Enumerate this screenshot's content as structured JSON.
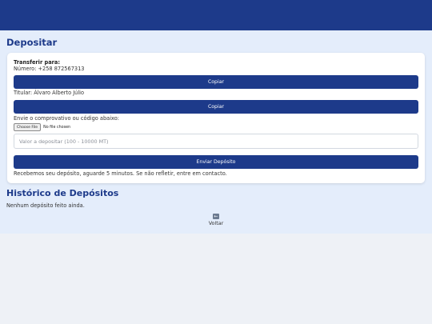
{
  "header": {
    "background": "#1d3a8a"
  },
  "page": {
    "title": "Depositar"
  },
  "deposit": {
    "transfer_label": "Transferir para:",
    "number_line": "Número: +258 872567313",
    "copy_button_1": "Copiar",
    "holder_line": "Titular: Álvaro Alberto Júlio",
    "copy_button_2": "Copiar",
    "proof_label": "Envie o comprovativo ou código abaixo:",
    "file_button": "Choose File",
    "file_status": "No file chosen",
    "amount_placeholder": "Valor a depositar (100 - 10000 MT)",
    "amount_value": "",
    "submit_button": "Enviar Depósito",
    "notice": "Recebemos seu depósito, aguarde 5 minutos. Se não refletir, entre em contacto."
  },
  "history": {
    "title": "Histórico de Depósitos",
    "empty_text": "Nenhum depósito feito ainda."
  },
  "nav": {
    "back_label": "Voltar",
    "back_icon": "back-arrow-icon"
  },
  "colors": {
    "accent": "#1d3a8a",
    "page_bg": "#e4edfb",
    "body_bg": "#eef1f6"
  }
}
